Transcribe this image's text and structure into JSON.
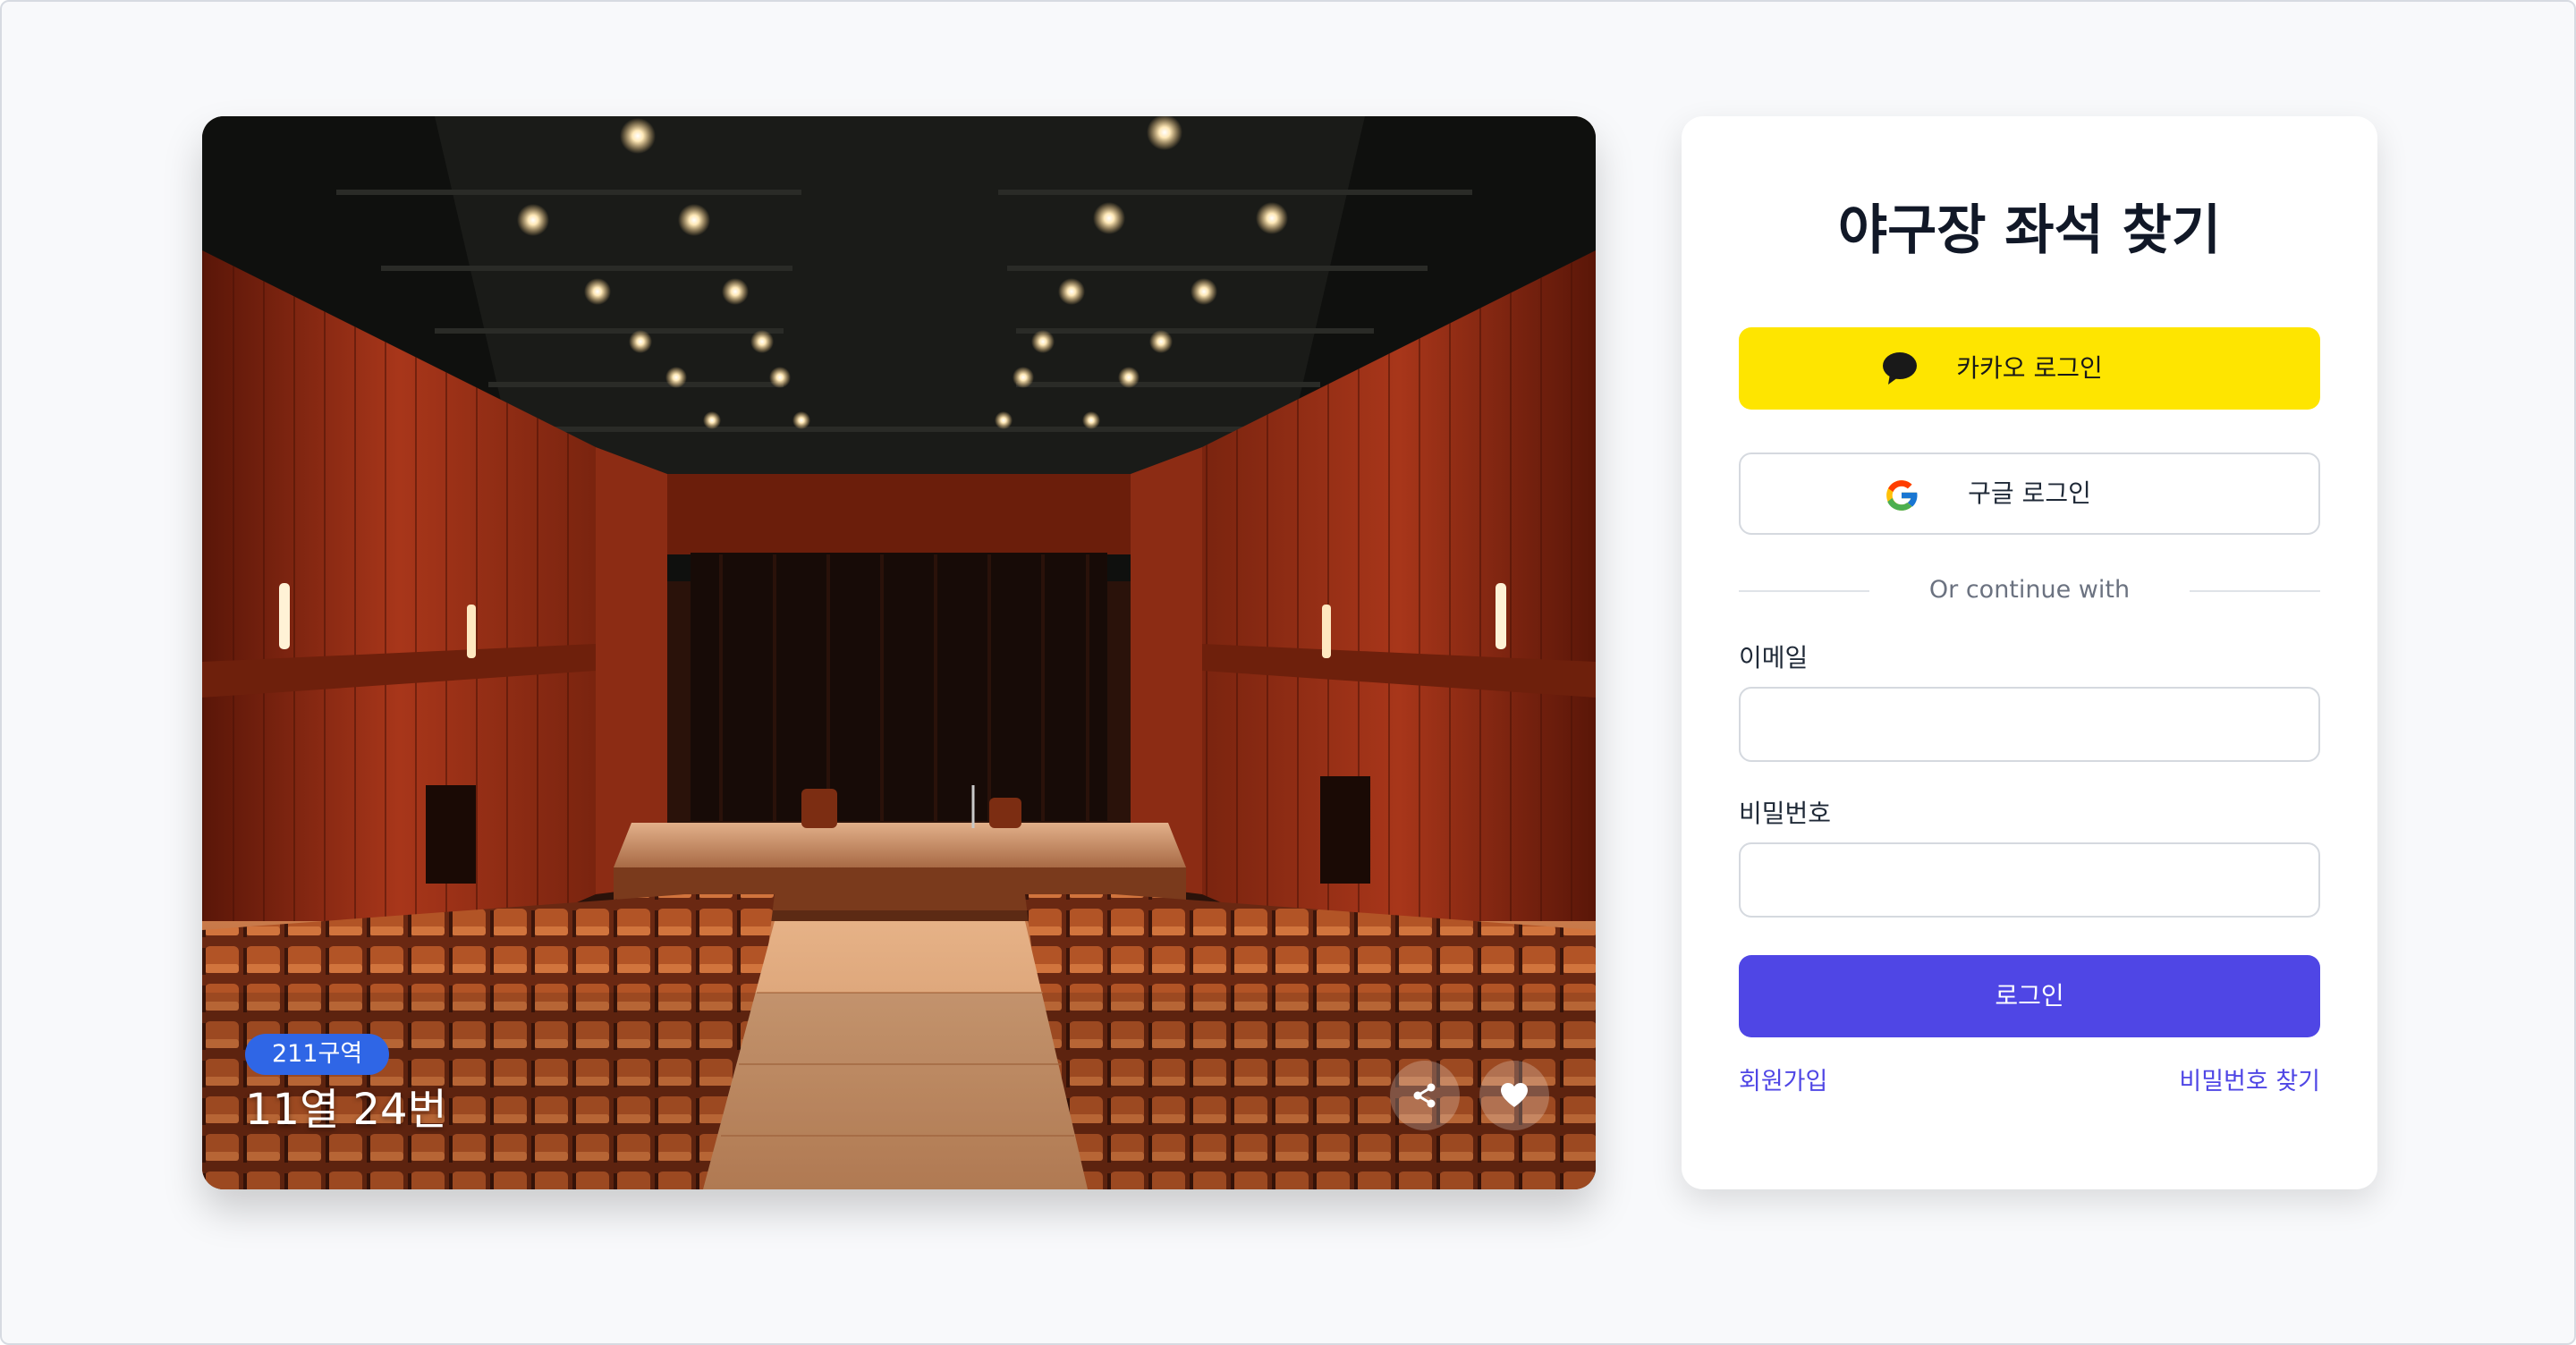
{
  "photo": {
    "section_badge": "211구역",
    "seat_label": "11열 24번",
    "share_icon": "share-icon",
    "heart_icon": "heart-icon"
  },
  "login": {
    "title": "야구장 좌석 찾기",
    "kakao": {
      "label": "카카오 로그인",
      "icon": "kakao-chat-icon",
      "color": "#FEE500"
    },
    "google": {
      "label": "구글 로그인",
      "icon": "google-g-icon"
    },
    "divider_text": "Or continue with",
    "email": {
      "label": "이메일",
      "value": "",
      "placeholder": ""
    },
    "password": {
      "label": "비밀번호",
      "value": "",
      "placeholder": ""
    },
    "submit_label": "로그인",
    "submit_color": "#4F46E5",
    "signup_link": "회원가입",
    "find_password_link": "비밀번호 찾기"
  }
}
